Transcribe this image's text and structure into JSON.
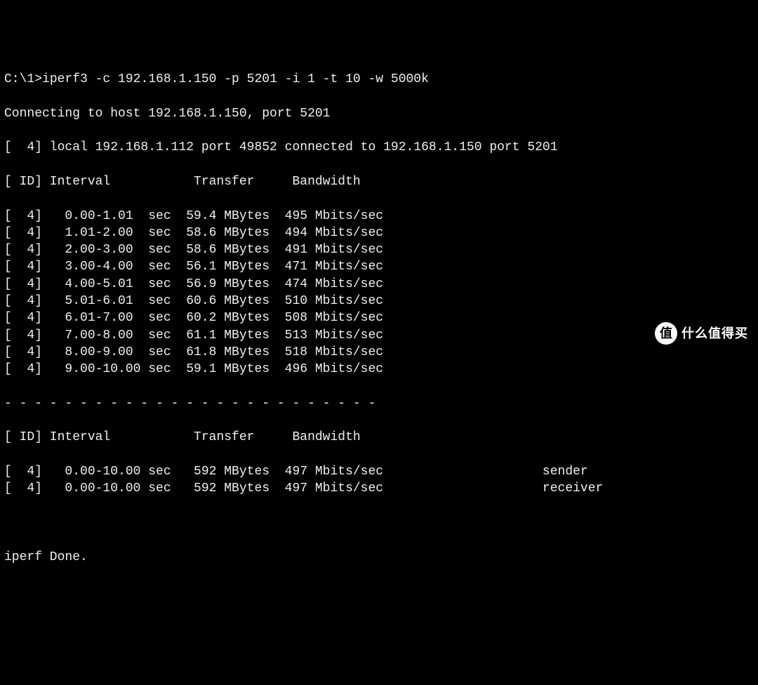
{
  "prompt": "C:\\1>",
  "command": "iperf3 -c 192.168.1.150 -p 5201 -i 1 -t 10 -w 5000k",
  "connecting": "Connecting to host 192.168.1.150, port 5201",
  "local_line": "[  4] local 192.168.1.112 port 49852 connected to 192.168.1.150 port 5201",
  "header": "[ ID] Interval           Transfer     Bandwidth",
  "rows": [
    {
      "id": "4",
      "interval": "0.00-1.01",
      "unit": "sec",
      "transfer": "59.4 MBytes",
      "bandwidth": "495 Mbits/sec"
    },
    {
      "id": "4",
      "interval": "1.01-2.00",
      "unit": "sec",
      "transfer": "58.6 MBytes",
      "bandwidth": "494 Mbits/sec"
    },
    {
      "id": "4",
      "interval": "2.00-3.00",
      "unit": "sec",
      "transfer": "58.6 MBytes",
      "bandwidth": "491 Mbits/sec"
    },
    {
      "id": "4",
      "interval": "3.00-4.00",
      "unit": "sec",
      "transfer": "56.1 MBytes",
      "bandwidth": "471 Mbits/sec"
    },
    {
      "id": "4",
      "interval": "4.00-5.01",
      "unit": "sec",
      "transfer": "56.9 MBytes",
      "bandwidth": "474 Mbits/sec"
    },
    {
      "id": "4",
      "interval": "5.01-6.01",
      "unit": "sec",
      "transfer": "60.6 MBytes",
      "bandwidth": "510 Mbits/sec"
    },
    {
      "id": "4",
      "interval": "6.01-7.00",
      "unit": "sec",
      "transfer": "60.2 MBytes",
      "bandwidth": "508 Mbits/sec"
    },
    {
      "id": "4",
      "interval": "7.00-8.00",
      "unit": "sec",
      "transfer": "61.1 MBytes",
      "bandwidth": "513 Mbits/sec"
    },
    {
      "id": "4",
      "interval": "8.00-9.00",
      "unit": "sec",
      "transfer": "61.8 MBytes",
      "bandwidth": "518 Mbits/sec"
    },
    {
      "id": "4",
      "interval": "9.00-10.00",
      "unit": "sec",
      "transfer": "59.1 MBytes",
      "bandwidth": "496 Mbits/sec"
    }
  ],
  "separator": "- - - - - - - - - - - - - - - - - - - - - - - - -",
  "summary_header": "[ ID] Interval           Transfer     Bandwidth",
  "summary": [
    {
      "id": "4",
      "interval": "0.00-10.00",
      "unit": "sec",
      "transfer": " 592 MBytes",
      "bandwidth": "497 Mbits/sec",
      "role": "sender"
    },
    {
      "id": "4",
      "interval": "0.00-10.00",
      "unit": "sec",
      "transfer": " 592 MBytes",
      "bandwidth": "497 Mbits/sec",
      "role": "receiver"
    }
  ],
  "done": "iperf Done.",
  "watermark": {
    "badge": "值",
    "text": "什么值得买"
  }
}
